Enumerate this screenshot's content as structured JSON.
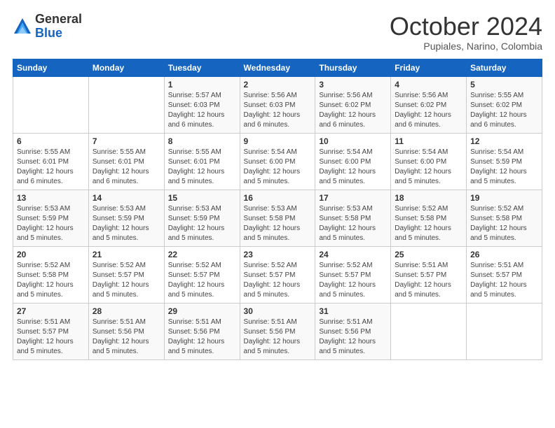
{
  "logo": {
    "general": "General",
    "blue": "Blue"
  },
  "header": {
    "month": "October 2024",
    "location": "Pupiales, Narino, Colombia"
  },
  "days_of_week": [
    "Sunday",
    "Monday",
    "Tuesday",
    "Wednesday",
    "Thursday",
    "Friday",
    "Saturday"
  ],
  "weeks": [
    [
      {
        "day": "",
        "info": ""
      },
      {
        "day": "",
        "info": ""
      },
      {
        "day": "1",
        "info": "Sunrise: 5:57 AM\nSunset: 6:03 PM\nDaylight: 12 hours\nand 6 minutes."
      },
      {
        "day": "2",
        "info": "Sunrise: 5:56 AM\nSunset: 6:03 PM\nDaylight: 12 hours\nand 6 minutes."
      },
      {
        "day": "3",
        "info": "Sunrise: 5:56 AM\nSunset: 6:02 PM\nDaylight: 12 hours\nand 6 minutes."
      },
      {
        "day": "4",
        "info": "Sunrise: 5:56 AM\nSunset: 6:02 PM\nDaylight: 12 hours\nand 6 minutes."
      },
      {
        "day": "5",
        "info": "Sunrise: 5:55 AM\nSunset: 6:02 PM\nDaylight: 12 hours\nand 6 minutes."
      }
    ],
    [
      {
        "day": "6",
        "info": "Sunrise: 5:55 AM\nSunset: 6:01 PM\nDaylight: 12 hours\nand 6 minutes."
      },
      {
        "day": "7",
        "info": "Sunrise: 5:55 AM\nSunset: 6:01 PM\nDaylight: 12 hours\nand 6 minutes."
      },
      {
        "day": "8",
        "info": "Sunrise: 5:55 AM\nSunset: 6:01 PM\nDaylight: 12 hours\nand 5 minutes."
      },
      {
        "day": "9",
        "info": "Sunrise: 5:54 AM\nSunset: 6:00 PM\nDaylight: 12 hours\nand 5 minutes."
      },
      {
        "day": "10",
        "info": "Sunrise: 5:54 AM\nSunset: 6:00 PM\nDaylight: 12 hours\nand 5 minutes."
      },
      {
        "day": "11",
        "info": "Sunrise: 5:54 AM\nSunset: 6:00 PM\nDaylight: 12 hours\nand 5 minutes."
      },
      {
        "day": "12",
        "info": "Sunrise: 5:54 AM\nSunset: 5:59 PM\nDaylight: 12 hours\nand 5 minutes."
      }
    ],
    [
      {
        "day": "13",
        "info": "Sunrise: 5:53 AM\nSunset: 5:59 PM\nDaylight: 12 hours\nand 5 minutes."
      },
      {
        "day": "14",
        "info": "Sunrise: 5:53 AM\nSunset: 5:59 PM\nDaylight: 12 hours\nand 5 minutes."
      },
      {
        "day": "15",
        "info": "Sunrise: 5:53 AM\nSunset: 5:59 PM\nDaylight: 12 hours\nand 5 minutes."
      },
      {
        "day": "16",
        "info": "Sunrise: 5:53 AM\nSunset: 5:58 PM\nDaylight: 12 hours\nand 5 minutes."
      },
      {
        "day": "17",
        "info": "Sunrise: 5:53 AM\nSunset: 5:58 PM\nDaylight: 12 hours\nand 5 minutes."
      },
      {
        "day": "18",
        "info": "Sunrise: 5:52 AM\nSunset: 5:58 PM\nDaylight: 12 hours\nand 5 minutes."
      },
      {
        "day": "19",
        "info": "Sunrise: 5:52 AM\nSunset: 5:58 PM\nDaylight: 12 hours\nand 5 minutes."
      }
    ],
    [
      {
        "day": "20",
        "info": "Sunrise: 5:52 AM\nSunset: 5:58 PM\nDaylight: 12 hours\nand 5 minutes."
      },
      {
        "day": "21",
        "info": "Sunrise: 5:52 AM\nSunset: 5:57 PM\nDaylight: 12 hours\nand 5 minutes."
      },
      {
        "day": "22",
        "info": "Sunrise: 5:52 AM\nSunset: 5:57 PM\nDaylight: 12 hours\nand 5 minutes."
      },
      {
        "day": "23",
        "info": "Sunrise: 5:52 AM\nSunset: 5:57 PM\nDaylight: 12 hours\nand 5 minutes."
      },
      {
        "day": "24",
        "info": "Sunrise: 5:52 AM\nSunset: 5:57 PM\nDaylight: 12 hours\nand 5 minutes."
      },
      {
        "day": "25",
        "info": "Sunrise: 5:51 AM\nSunset: 5:57 PM\nDaylight: 12 hours\nand 5 minutes."
      },
      {
        "day": "26",
        "info": "Sunrise: 5:51 AM\nSunset: 5:57 PM\nDaylight: 12 hours\nand 5 minutes."
      }
    ],
    [
      {
        "day": "27",
        "info": "Sunrise: 5:51 AM\nSunset: 5:57 PM\nDaylight: 12 hours\nand 5 minutes."
      },
      {
        "day": "28",
        "info": "Sunrise: 5:51 AM\nSunset: 5:56 PM\nDaylight: 12 hours\nand 5 minutes."
      },
      {
        "day": "29",
        "info": "Sunrise: 5:51 AM\nSunset: 5:56 PM\nDaylight: 12 hours\nand 5 minutes."
      },
      {
        "day": "30",
        "info": "Sunrise: 5:51 AM\nSunset: 5:56 PM\nDaylight: 12 hours\nand 5 minutes."
      },
      {
        "day": "31",
        "info": "Sunrise: 5:51 AM\nSunset: 5:56 PM\nDaylight: 12 hours\nand 5 minutes."
      },
      {
        "day": "",
        "info": ""
      },
      {
        "day": "",
        "info": ""
      }
    ]
  ]
}
